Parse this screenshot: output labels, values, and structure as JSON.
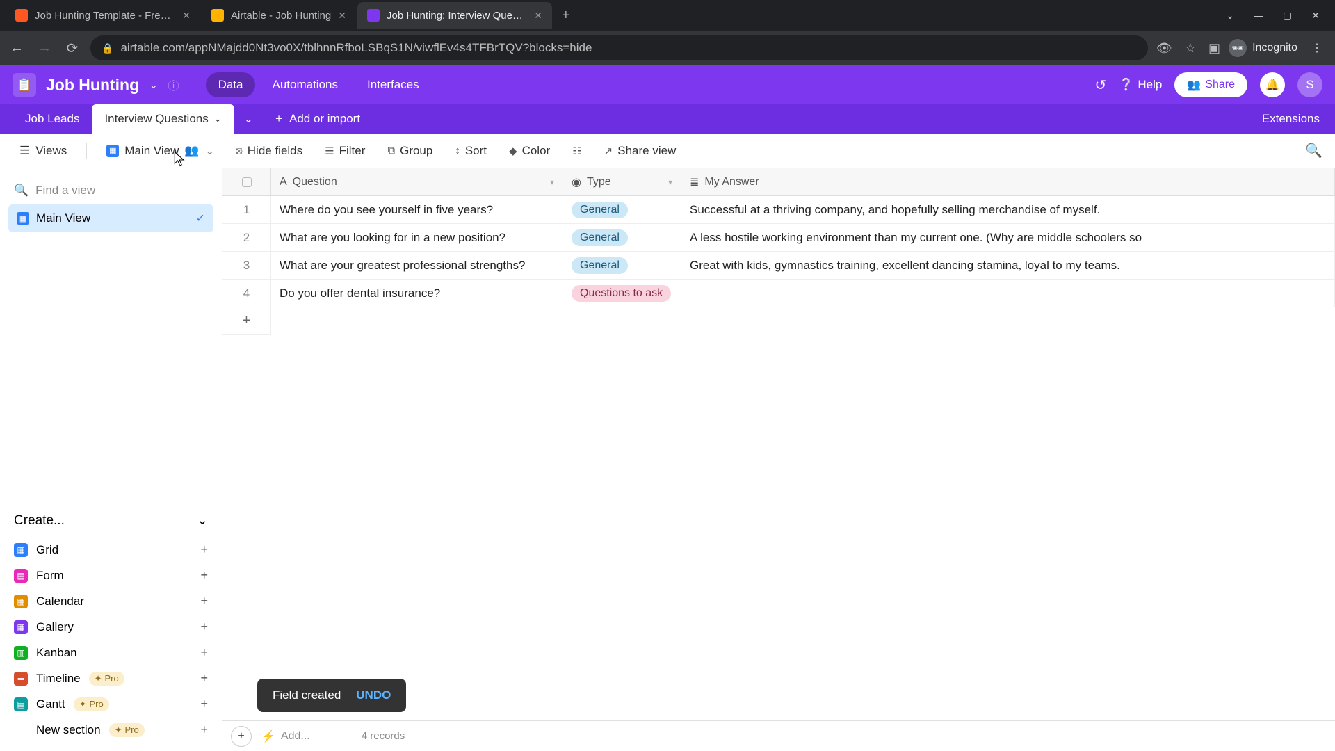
{
  "browser": {
    "tabs": [
      {
        "title": "Job Hunting Template - Free to U",
        "active": false,
        "favicon": "#ff5722"
      },
      {
        "title": "Airtable - Job Hunting",
        "active": false,
        "favicon": "#ffb300"
      },
      {
        "title": "Job Hunting: Interview Questions",
        "active": true,
        "favicon": "#7c37ef"
      }
    ],
    "url": "airtable.com/appNMajdd0Nt3vo0X/tblhnnRfboLSBqS1N/viwflEv4s4TFBrTQV?blocks=hide",
    "incognito_label": "Incognito"
  },
  "header": {
    "base_name": "Job Hunting",
    "tabs": {
      "data": "Data",
      "automations": "Automations",
      "interfaces": "Interfaces"
    },
    "help": "Help",
    "share": "Share",
    "avatar_initial": "S"
  },
  "table_tabs": {
    "items": [
      "Job Leads",
      "Interview Questions"
    ],
    "active": 1,
    "add_label": "Add or import",
    "extensions": "Extensions"
  },
  "toolbar": {
    "views": "Views",
    "view_name": "Main View",
    "hide_fields": "Hide fields",
    "filter": "Filter",
    "group": "Group",
    "sort": "Sort",
    "color": "Color",
    "share_view": "Share view"
  },
  "sidebar": {
    "find_placeholder": "Find a view",
    "views": [
      {
        "name": "Main View",
        "active": true
      }
    ],
    "create_label": "Create...",
    "create_items": [
      {
        "label": "Grid",
        "color": "#2d7ff9",
        "pro": false
      },
      {
        "label": "Form",
        "color": "#e929ba",
        "pro": false
      },
      {
        "label": "Calendar",
        "color": "#e08d00",
        "pro": false
      },
      {
        "label": "Gallery",
        "color": "#7c37ef",
        "pro": false
      },
      {
        "label": "Kanban",
        "color": "#11af22",
        "pro": false
      },
      {
        "label": "Timeline",
        "color": "#d54d2a",
        "pro": true
      },
      {
        "label": "Gantt",
        "color": "#0f9d9f",
        "pro": true
      }
    ],
    "new_section": "New section",
    "pro_label": "Pro"
  },
  "grid": {
    "columns": {
      "question": "Question",
      "type": "Type",
      "answer": "My Answer"
    },
    "rows": [
      {
        "n": "1",
        "question": "Where do you see yourself in five years?",
        "type": "General",
        "type_class": "general",
        "answer": "Successful at a thriving company, and hopefully selling merchandise of myself."
      },
      {
        "n": "2",
        "question": "What are you looking for in a new position?",
        "type": "General",
        "type_class": "general",
        "answer": "A less hostile working environment than my current one. (Why are middle schoolers so"
      },
      {
        "n": "3",
        "question": "What are your greatest professional strengths?",
        "type": "General",
        "type_class": "general",
        "answer": "Great with kids, gymnastics training, excellent dancing stamina, loyal to my teams."
      },
      {
        "n": "4",
        "question": "Do you offer dental insurance?",
        "type": "Questions to ask",
        "type_class": "questions",
        "answer": ""
      }
    ],
    "record_count": "4 records",
    "footer_add": "Add..."
  },
  "toast": {
    "message": "Field created",
    "undo": "UNDO"
  }
}
